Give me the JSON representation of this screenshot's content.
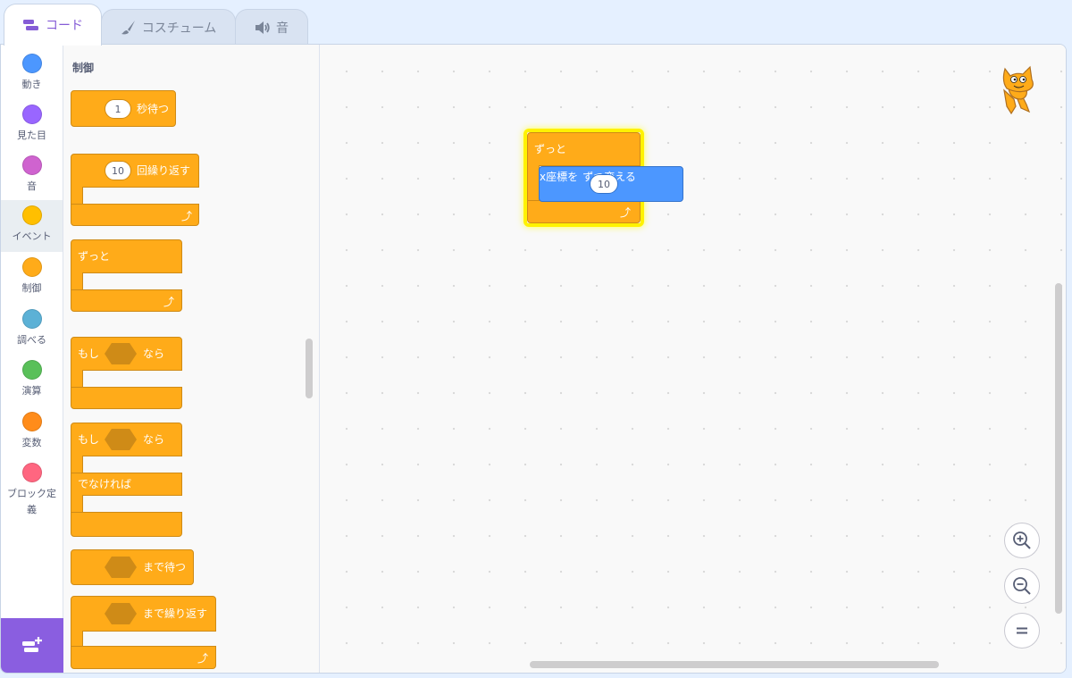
{
  "tabs": {
    "code": "コード",
    "costumes": "コスチューム",
    "sounds": "音"
  },
  "categories": [
    {
      "label": "動き",
      "color": "#4c97ff"
    },
    {
      "label": "見た目",
      "color": "#9966ff"
    },
    {
      "label": "音",
      "color": "#cf63cf"
    },
    {
      "label": "イベント",
      "color": "#ffbf00"
    },
    {
      "label": "制御",
      "color": "#ffab19"
    },
    {
      "label": "調べる",
      "color": "#5cb1d6"
    },
    {
      "label": "演算",
      "color": "#59c059"
    },
    {
      "label": "変数",
      "color": "#ff8c1a"
    },
    {
      "label": "ブロック定義",
      "color": "#ff6680"
    }
  ],
  "selected_category": "イベント",
  "palette": {
    "title": "制御",
    "wait": {
      "value": "1",
      "label": "秒待つ"
    },
    "repeat": {
      "value": "10",
      "label": "回繰り返す"
    },
    "forever": {
      "label": "ずっと"
    },
    "if_then": {
      "prefix": "もし",
      "suffix": "なら"
    },
    "if_else": {
      "prefix": "もし",
      "suffix": "なら",
      "else": "でなければ"
    },
    "wait_until": {
      "label": "まで待つ"
    },
    "repeat_until": {
      "label": "まで繰り返す"
    }
  },
  "workspace": {
    "forever_label": "ずっと",
    "change_x": {
      "prefix": "x座標を",
      "value": "10",
      "suffix": "ずつ変える"
    }
  },
  "colors": {
    "control": "#ffab19",
    "motion": "#4c97ff",
    "accent": "#855cd6",
    "highlight": "#fff200"
  }
}
